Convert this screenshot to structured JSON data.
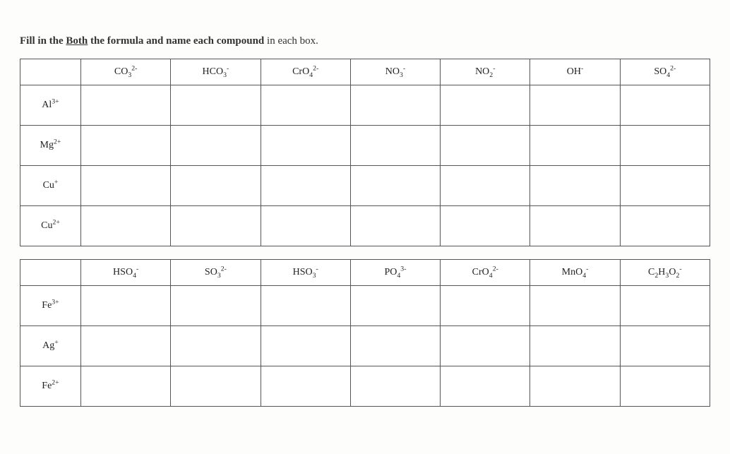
{
  "instruction": {
    "prefix": "Fill in the ",
    "underlined": "Both",
    "middle": " the formula and name each compound",
    "suffix": " in each box."
  },
  "table1": {
    "anion_headers": [
      {
        "html": "CO<sub>3</sub><sup>2-</sup>"
      },
      {
        "html": "HCO<sub>3</sub><sup>-</sup>"
      },
      {
        "html": "CrO<sub>4</sub><sup>2-</sup>"
      },
      {
        "html": "NO<sub>3</sub><sup>-</sup>"
      },
      {
        "html": "NO<sub>2</sub><sup>-</sup>"
      },
      {
        "html": "OH<sup>-</sup>"
      },
      {
        "html": "SO<sub>4</sub><sup>2-</sup>"
      }
    ],
    "cation_rows": [
      {
        "html": "Al<sup>3+</sup>"
      },
      {
        "html": "Mg<sup>2+</sup>"
      },
      {
        "html": "Cu<sup>+</sup>"
      },
      {
        "html": "Cu<sup>2+</sup>"
      }
    ]
  },
  "table2": {
    "anion_headers": [
      {
        "html": "HSO<sub>4</sub><sup>-</sup>"
      },
      {
        "html": "SO<sub>3</sub><sup>2-</sup>"
      },
      {
        "html": "HSO<sub>3</sub><sup>-</sup>"
      },
      {
        "html": "PO<sub>4</sub><sup>3-</sup>"
      },
      {
        "html": "CrO<sub>4</sub><sup>2-</sup>"
      },
      {
        "html": "MnO<sub>4</sub><sup>-</sup>"
      },
      {
        "html": "C<sub>2</sub>H<sub>3</sub>O<sub>2</sub><sup>-</sup>"
      }
    ],
    "cation_rows": [
      {
        "html": "Fe<sup>3+</sup>"
      },
      {
        "html": "Ag<sup>+</sup>"
      },
      {
        "html": "Fe<sup>2+</sup>"
      }
    ]
  }
}
